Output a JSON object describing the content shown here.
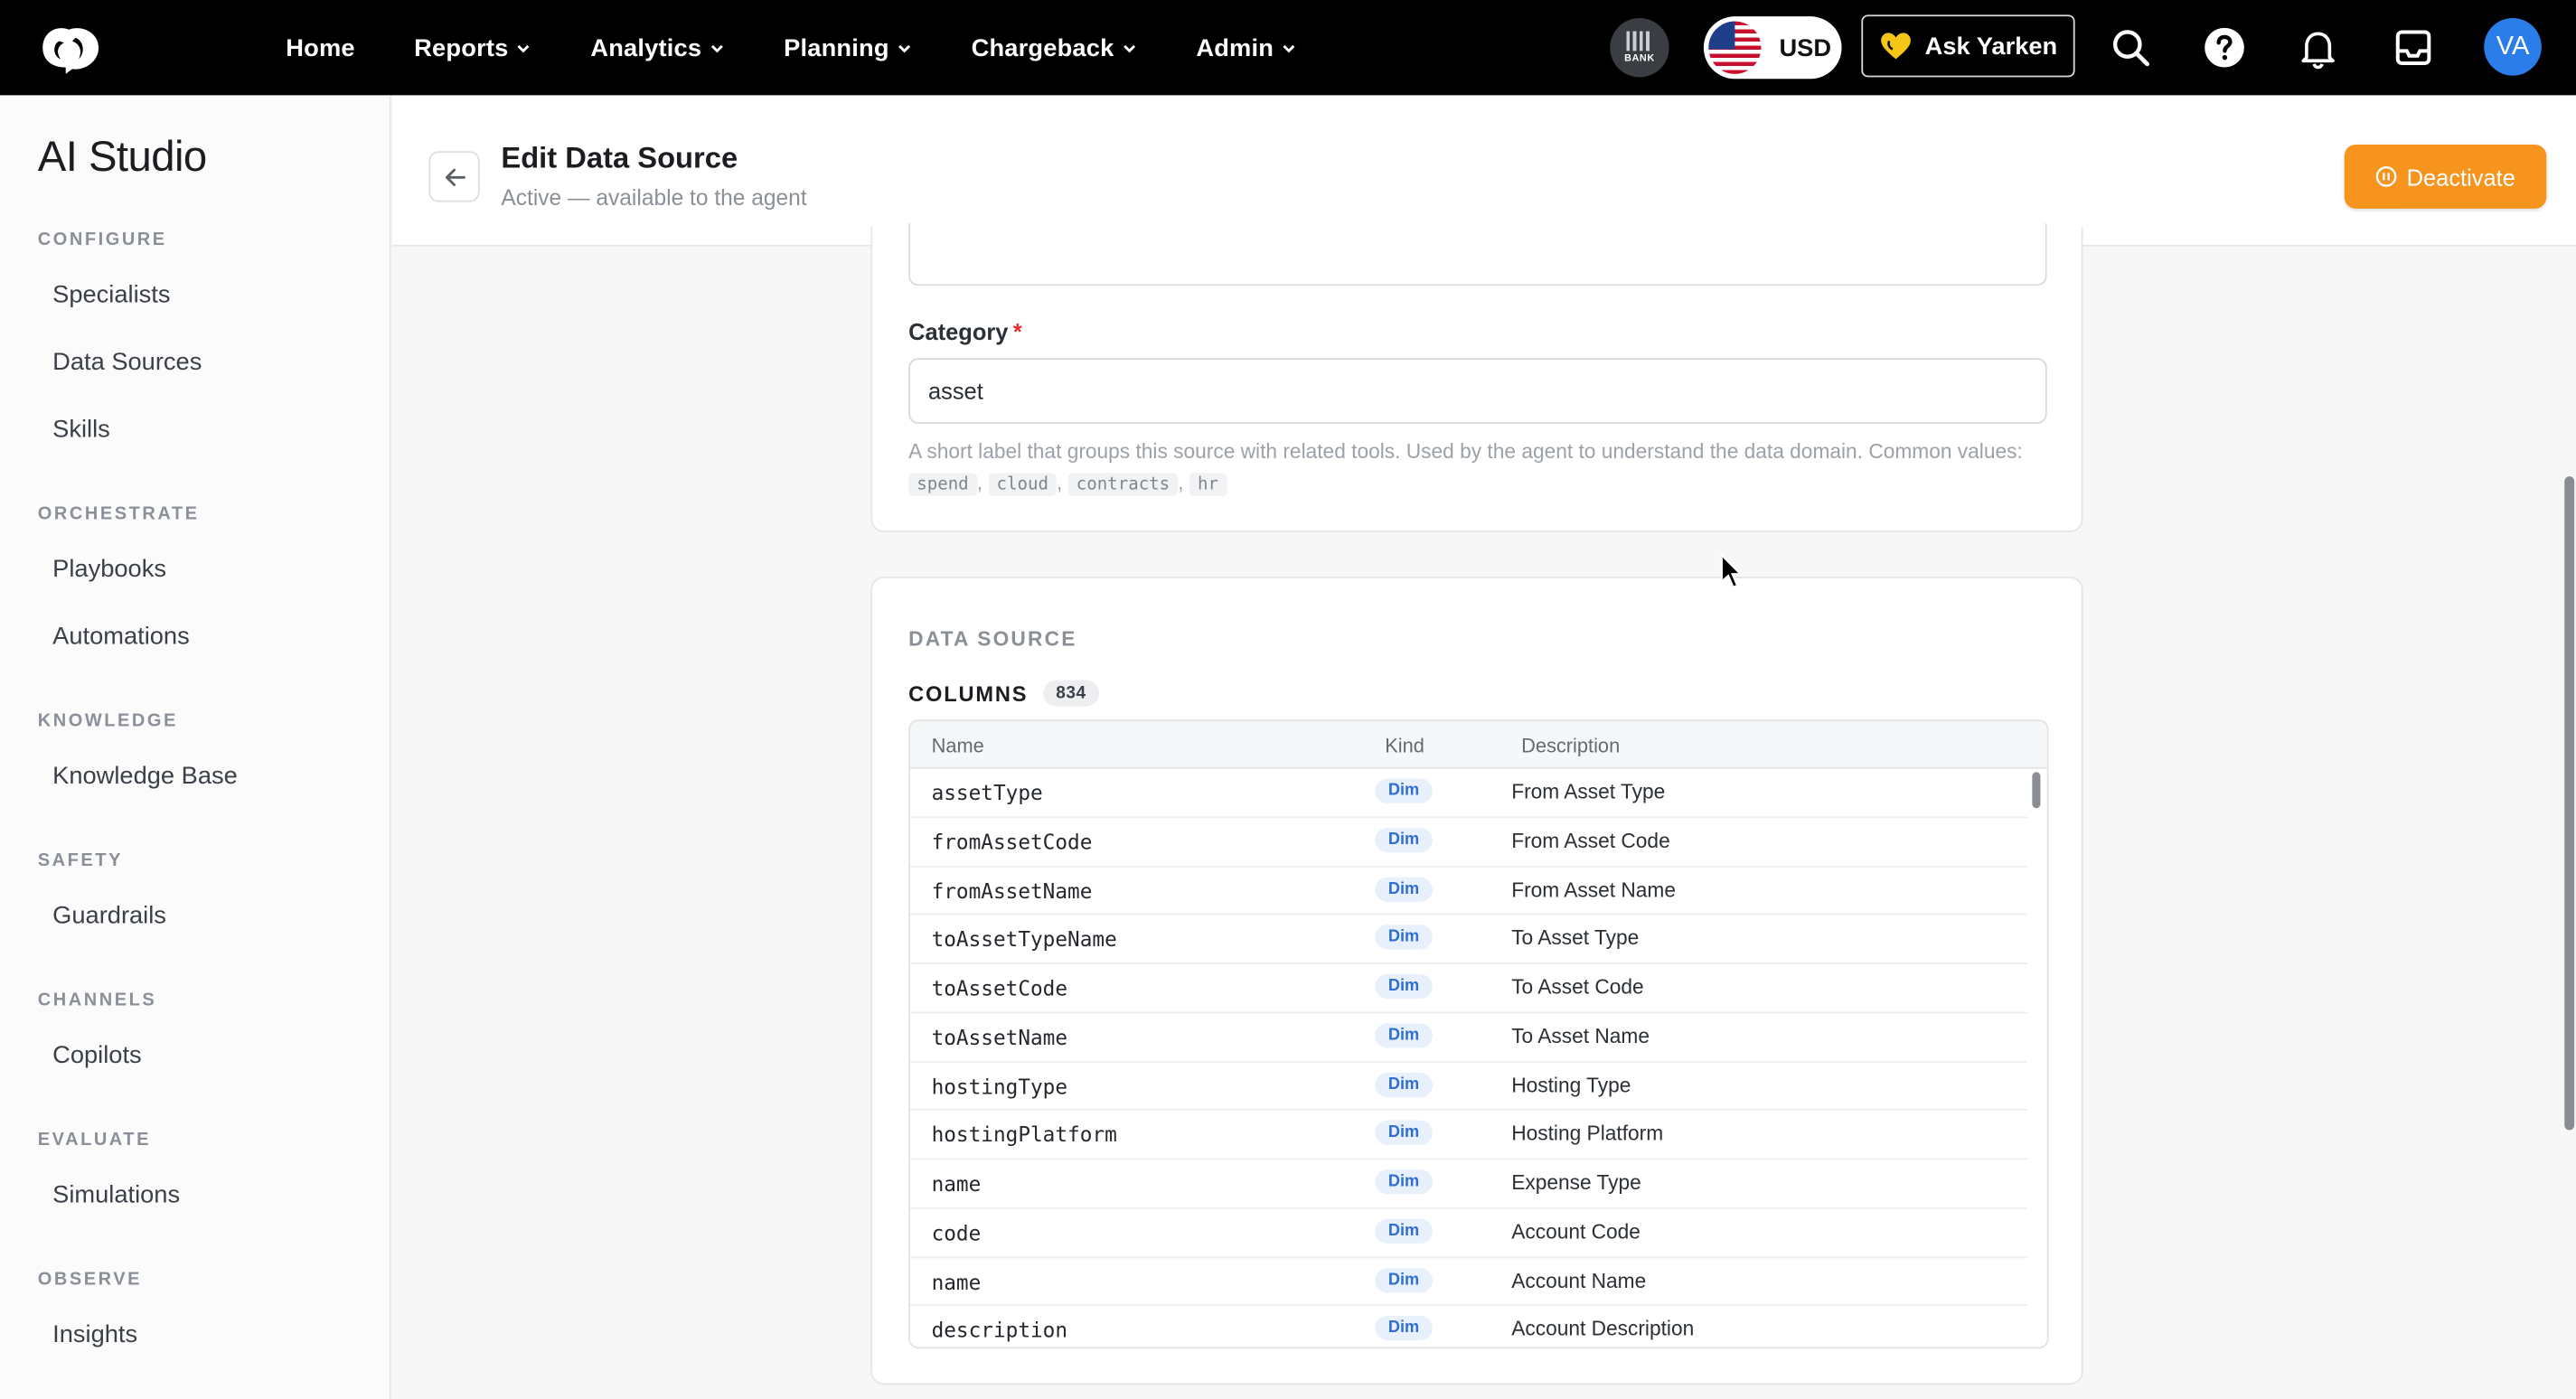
{
  "topbar": {
    "nav": [
      {
        "label": "Home",
        "dropdown": false
      },
      {
        "label": "Reports",
        "dropdown": true
      },
      {
        "label": "Analytics",
        "dropdown": true
      },
      {
        "label": "Planning",
        "dropdown": true
      },
      {
        "label": "Chargeback",
        "dropdown": true
      },
      {
        "label": "Admin",
        "dropdown": true
      }
    ],
    "bank_label": "BANK",
    "currency": "USD",
    "ask_label": "Ask Yarken",
    "avatar_initials": "VA"
  },
  "sidebar": {
    "title": "AI Studio",
    "sections": [
      {
        "label": "CONFIGURE",
        "items": [
          "Specialists",
          "Data Sources",
          "Skills"
        ]
      },
      {
        "label": "ORCHESTRATE",
        "items": [
          "Playbooks",
          "Automations"
        ]
      },
      {
        "label": "KNOWLEDGE",
        "items": [
          "Knowledge Base"
        ]
      },
      {
        "label": "SAFETY",
        "items": [
          "Guardrails"
        ]
      },
      {
        "label": "CHANNELS",
        "items": [
          "Copilots"
        ]
      },
      {
        "label": "EVALUATE",
        "items": [
          "Simulations"
        ]
      },
      {
        "label": "OBSERVE",
        "items": [
          "Insights"
        ]
      }
    ]
  },
  "header": {
    "title": "Edit Data Source",
    "subtitle": "Active — available to the agent",
    "deactivate_label": "Deactivate"
  },
  "form": {
    "category_label": "Category",
    "category_required": "*",
    "category_value": "asset",
    "help_text": "A short label that groups this source with related tools. Used by the agent to understand the data domain. Common values:",
    "common_values": [
      "spend",
      "cloud",
      "contracts",
      "hr"
    ]
  },
  "data_source": {
    "section_label": "DATA SOURCE",
    "columns_label": "COLUMNS",
    "columns_count": "834",
    "table_headers": {
      "name": "Name",
      "kind": "Kind",
      "description": "Description"
    },
    "rows": [
      {
        "name": "assetType",
        "kind": "Dim",
        "description": "From Asset Type"
      },
      {
        "name": "fromAssetCode",
        "kind": "Dim",
        "description": "From Asset Code"
      },
      {
        "name": "fromAssetName",
        "kind": "Dim",
        "description": "From Asset Name"
      },
      {
        "name": "toAssetTypeName",
        "kind": "Dim",
        "description": "To Asset Type"
      },
      {
        "name": "toAssetCode",
        "kind": "Dim",
        "description": "To Asset Code"
      },
      {
        "name": "toAssetName",
        "kind": "Dim",
        "description": "To Asset Name"
      },
      {
        "name": "hostingType",
        "kind": "Dim",
        "description": "Hosting Type"
      },
      {
        "name": "hostingPlatform",
        "kind": "Dim",
        "description": "Hosting Platform"
      },
      {
        "name": "name",
        "kind": "Dim",
        "description": "Expense Type"
      },
      {
        "name": "code",
        "kind": "Dim",
        "description": "Account Code"
      },
      {
        "name": "name",
        "kind": "Dim",
        "description": "Account Name"
      },
      {
        "name": "description",
        "kind": "Dim",
        "description": "Account Description"
      }
    ]
  },
  "colors": {
    "topbar": "#000000",
    "accent_orange": "#f7941d",
    "avatar_blue": "#2b7de9",
    "dim_badge": "#2f6fd1"
  }
}
